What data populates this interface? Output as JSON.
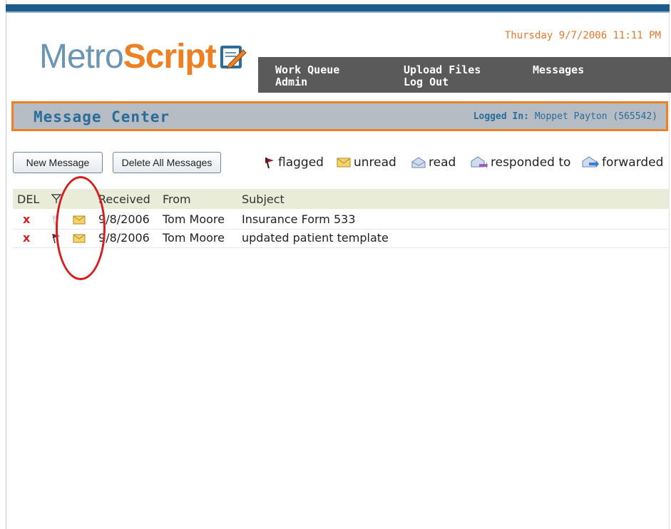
{
  "header": {
    "datetime": "Thursday 9/7/2006 11:11 PM",
    "logo_part1": "Metro",
    "logo_part2": "Script",
    "nav": [
      {
        "label": "Work Queue"
      },
      {
        "label": "Upload Files"
      },
      {
        "label": "Messages"
      },
      {
        "label": "Admin"
      },
      {
        "label": "Log Out"
      }
    ]
  },
  "message_center": {
    "title": "Message Center",
    "logged_in_label": "Logged In:",
    "logged_in_user": "Moppet Payton (565542)"
  },
  "toolbar": {
    "new_message": "New Message",
    "delete_all": "Delete All Messages"
  },
  "legend": {
    "flagged": "flagged",
    "unread": "unread",
    "read": "read",
    "responded": "responded to",
    "forwarded": "forwarded"
  },
  "table": {
    "headers": {
      "del": "DEL",
      "received": "Received",
      "from": "From",
      "subject": "Subject"
    },
    "rows": [
      {
        "del": "x",
        "received": "9/8/2006",
        "from": "Tom Moore",
        "subject": "Insurance Form 533",
        "flagged": false,
        "status": "unread"
      },
      {
        "del": "x",
        "received": "9/8/2006",
        "from": "Tom Moore",
        "subject": "updated patient template",
        "flagged": true,
        "status": "unread"
      }
    ]
  },
  "colors": {
    "brand_blue": "#1d5b8c",
    "brand_orange": "#ee7f22",
    "nav_bg": "#5a5a5a",
    "delete_red": "#d41f1f",
    "annotation_red": "#d41f1f"
  }
}
